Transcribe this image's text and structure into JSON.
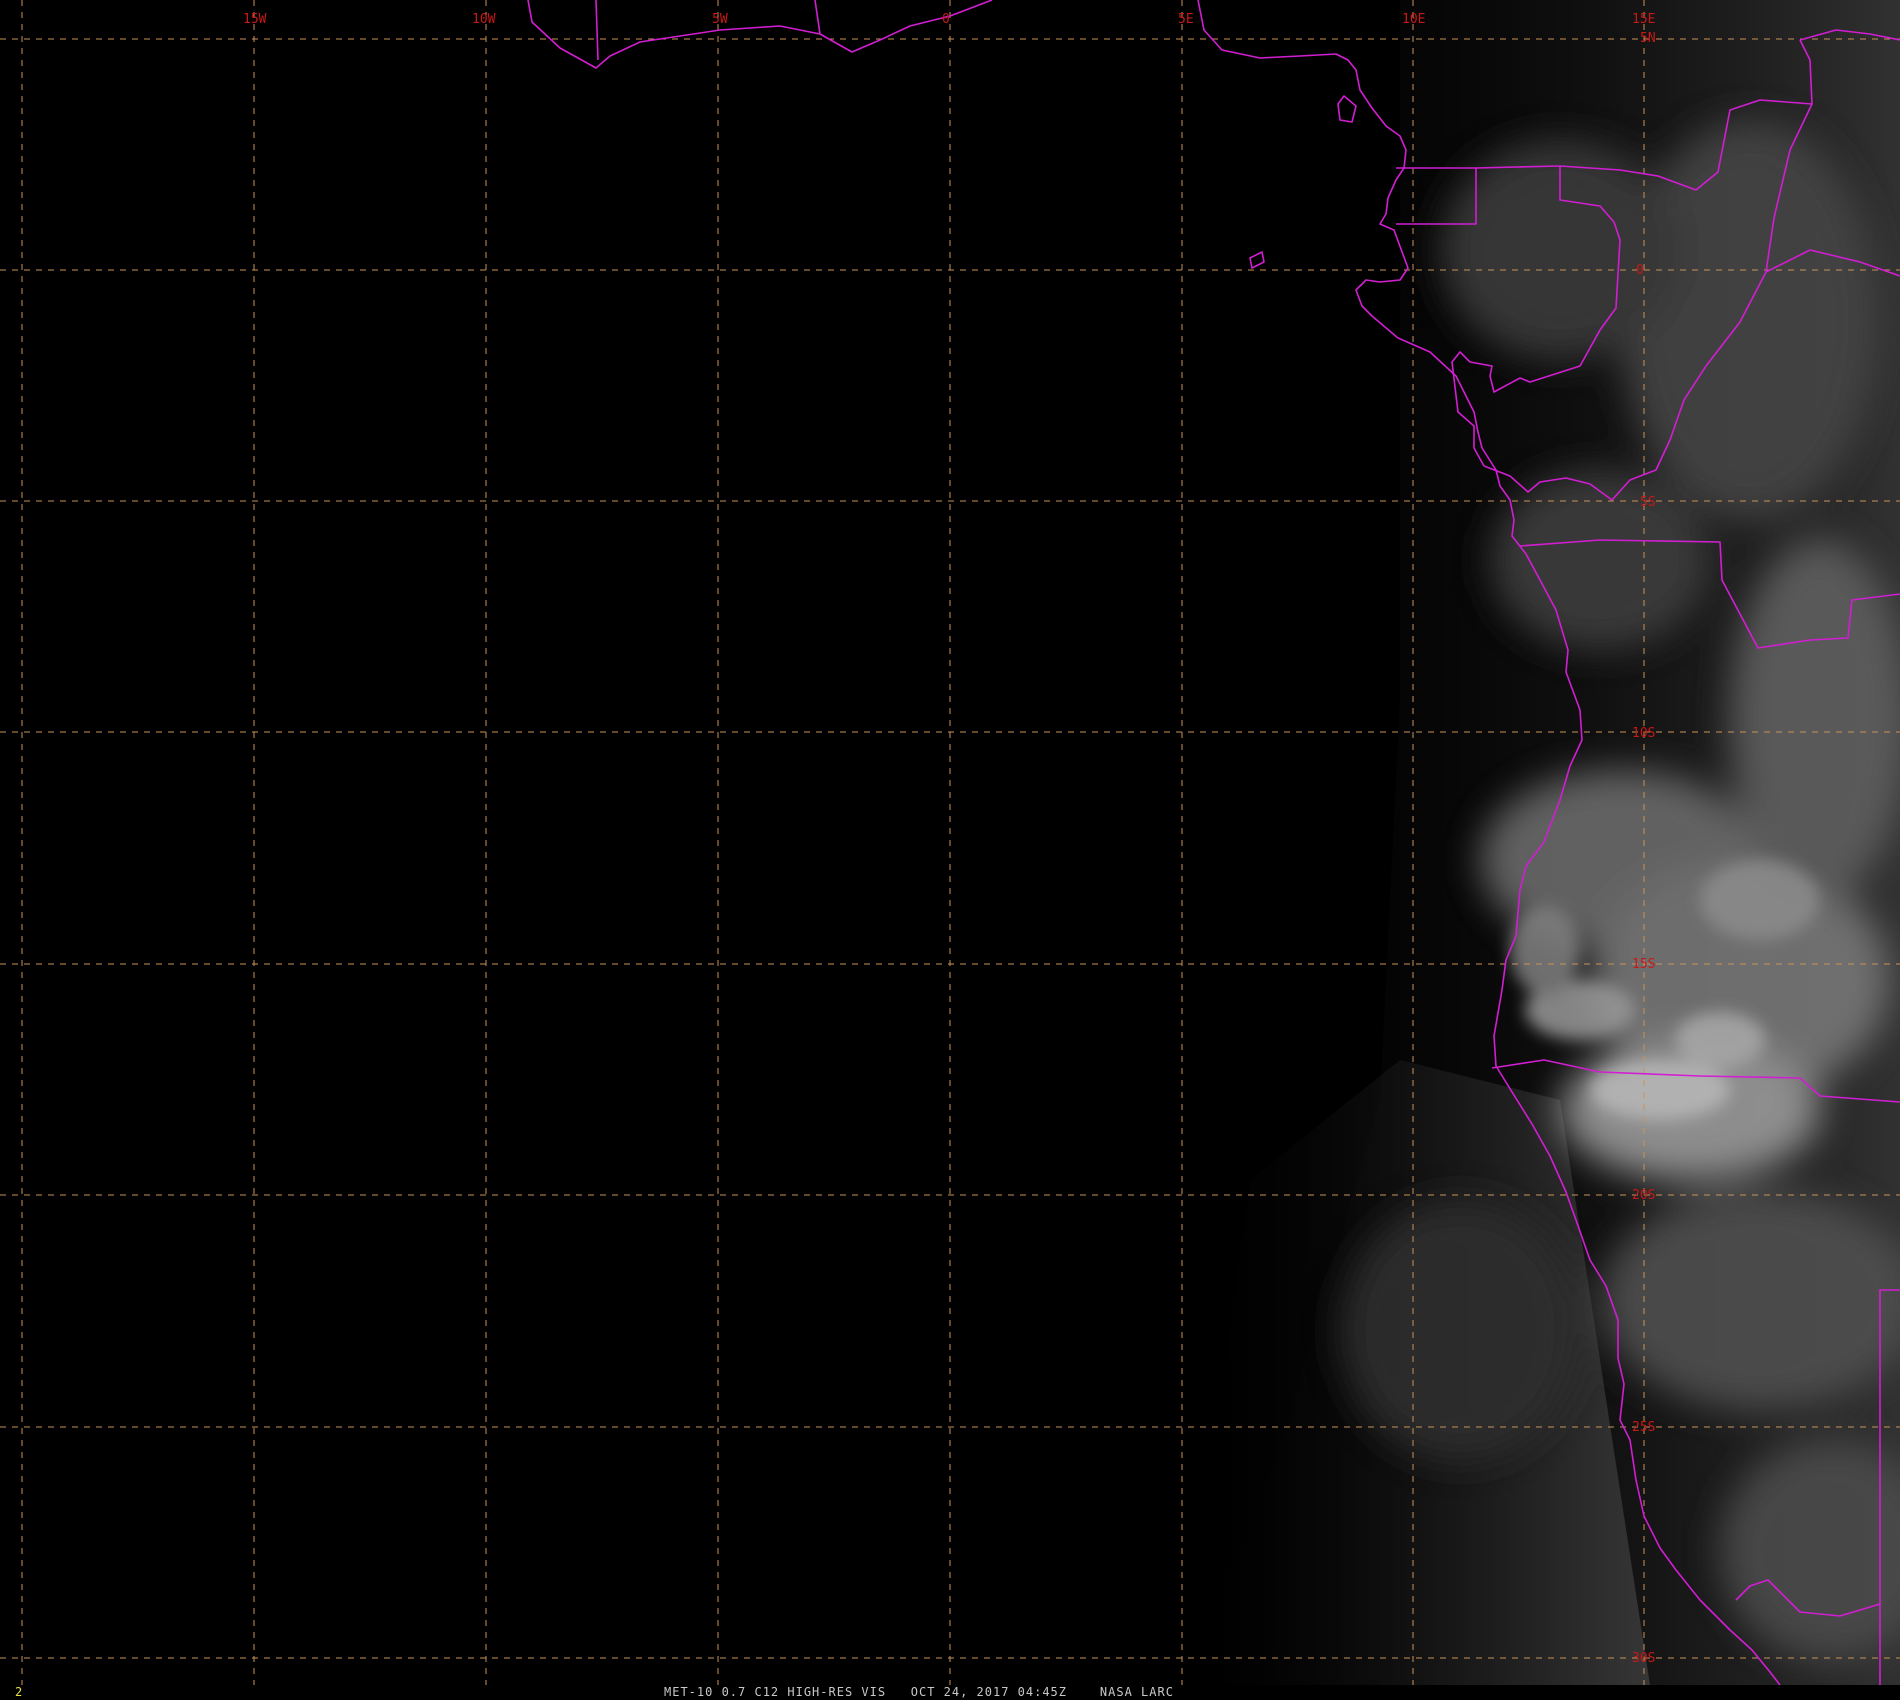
{
  "frame_number": "2",
  "caption": "MET-10 0.7 C12 HIGH-RES VIS   OCT 24, 2017 04:45Z    NASA LARC",
  "colors": {
    "background": "#000000",
    "gridlines": "#c8925a",
    "grid_labels": "#c81818",
    "borders": "#d21ed2",
    "caption_text": "#c8c8c8",
    "frame_number_text": "#e0e040"
  },
  "map": {
    "longitude_labels": [
      "15W",
      "10W",
      "5W",
      "0",
      "5E",
      "10E",
      "15E"
    ],
    "latitude_labels": [
      "5N",
      "0",
      "5S",
      "10S",
      "15S",
      "20S",
      "25S",
      "30S"
    ]
  }
}
